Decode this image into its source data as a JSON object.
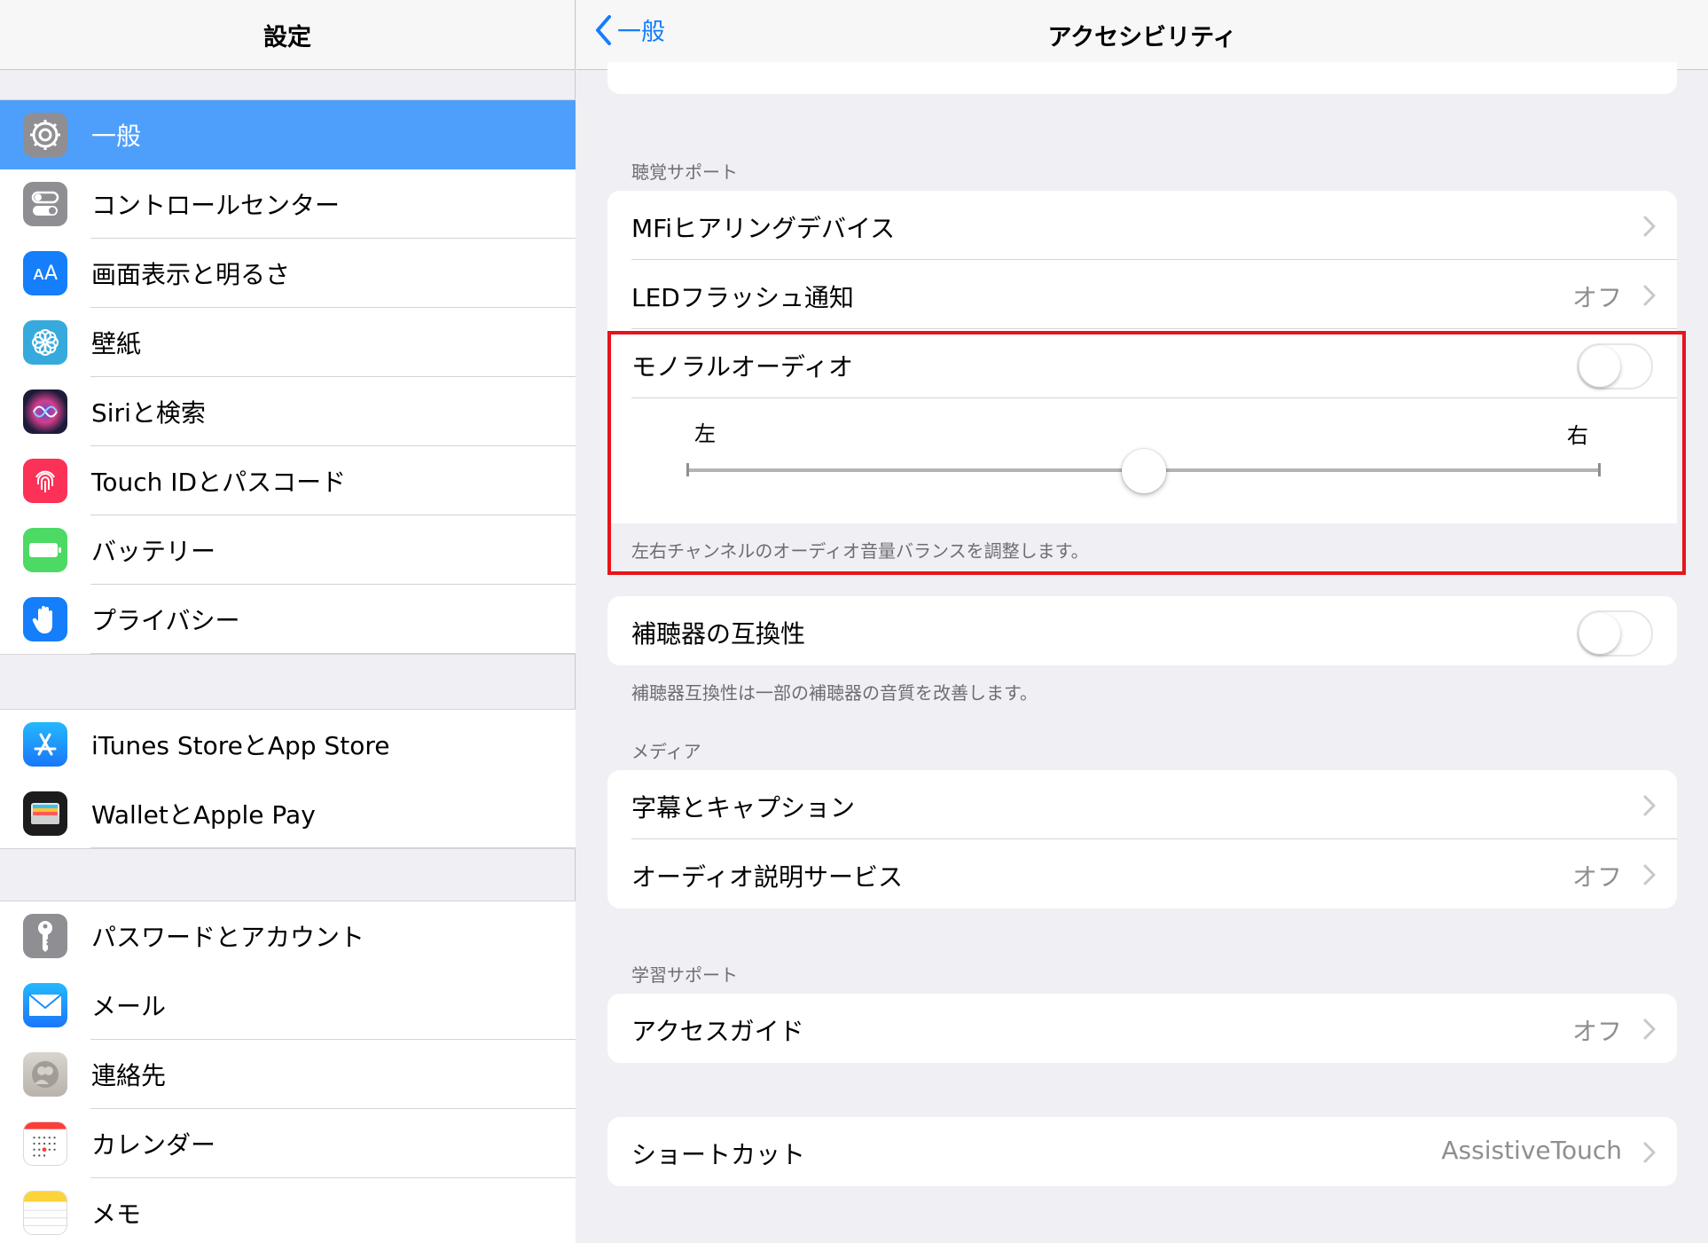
{
  "sidebar": {
    "title": "設定",
    "groups": [
      [
        {
          "label": "一般",
          "icon": "gear-icon",
          "color": "#8e8e93",
          "selected": true
        },
        {
          "label": "コントロールセンター",
          "icon": "switches-icon",
          "color": "#8e8e93"
        },
        {
          "label": "画面表示と明るさ",
          "icon": "text-size-icon",
          "color": "#147efb"
        },
        {
          "label": "壁紙",
          "icon": "flower-icon",
          "color": "#36aadc"
        },
        {
          "label": "Siriと検索",
          "icon": "siri-icon",
          "color": "#1c1c3a"
        },
        {
          "label": "Touch IDとパスコード",
          "icon": "fingerprint-icon",
          "color": "#fc3158"
        },
        {
          "label": "バッテリー",
          "icon": "battery-icon",
          "color": "#4cd964"
        },
        {
          "label": "プライバシー",
          "icon": "hand-icon",
          "color": "#147efb"
        }
      ],
      [
        {
          "label": "iTunes StoreとApp Store",
          "icon": "app-store-icon",
          "color": "#1a8cfb"
        },
        {
          "label": "WalletとApple Pay",
          "icon": "wallet-icon",
          "color": "#1c1c1e"
        }
      ],
      [
        {
          "label": "パスワードとアカウント",
          "icon": "key-icon",
          "color": "#8e8e93"
        },
        {
          "label": "メール",
          "icon": "mail-icon",
          "color": "#1a8cfb"
        },
        {
          "label": "連絡先",
          "icon": "contacts-icon",
          "color": "#c7c3bd"
        },
        {
          "label": "カレンダー",
          "icon": "calendar-icon",
          "color": "#ffffff"
        },
        {
          "label": "メモ",
          "icon": "notes-icon",
          "color": "#ffffff"
        }
      ]
    ]
  },
  "detail": {
    "back_label": "一般",
    "title": "アクセシビリティ",
    "hearing_header": "聴覚サポート",
    "mfi_label": "MFiヒアリングデバイス",
    "led_label": "LEDフラッシュ通知",
    "led_value": "オフ",
    "mono_label": "モノラルオーディオ",
    "mono_on": false,
    "balance_left": "左",
    "balance_right": "右",
    "balance_value": 0.5,
    "balance_footer": "左右チャンネルのオーディオ音量バランスを調整します。",
    "hac_label": "補聴器の互換性",
    "hac_on": false,
    "hac_footer": "補聴器互換性は一部の補聴器の音質を改善します。",
    "media_header": "メディア",
    "captions_label": "字幕とキャプション",
    "audio_desc_label": "オーディオ説明サービス",
    "audio_desc_value": "オフ",
    "learning_header": "学習サポート",
    "guided_label": "アクセスガイド",
    "guided_value": "オフ",
    "shortcut_label": "ショートカット",
    "shortcut_value": "AssistiveTouch"
  }
}
